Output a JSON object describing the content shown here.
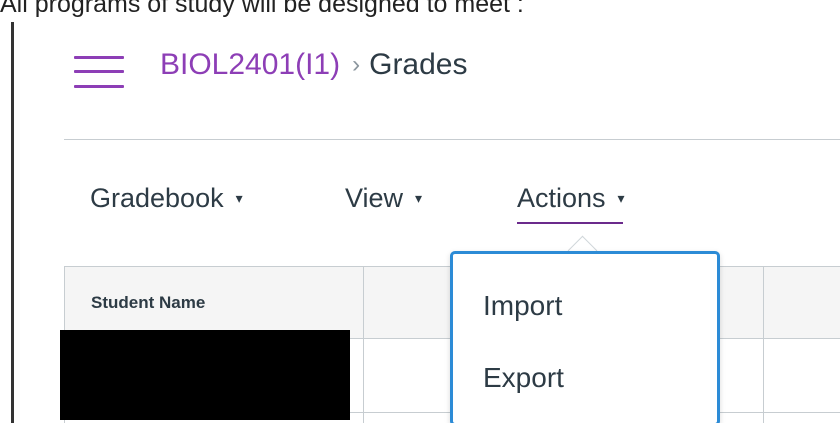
{
  "page_top_text": "All programs of study will be designed to meet :",
  "breadcrumb": {
    "course": "BIOL2401(I1)",
    "separator": "›",
    "current": "Grades"
  },
  "toolbar": {
    "gradebook_label": "Gradebook",
    "view_label": "View",
    "actions_label": "Actions",
    "caret": "▾"
  },
  "grid": {
    "student_name_header": "Student Name"
  },
  "actions_menu": {
    "items": [
      {
        "label": "Import"
      },
      {
        "label": "Export"
      }
    ]
  },
  "colors": {
    "brand_purple": "#8d3eb6",
    "focus_blue": "#2c8bd6",
    "text_dark": "#2d3b45"
  },
  "icons": {
    "menu": "hamburger-menu-icon",
    "caret": "caret-down-icon"
  }
}
